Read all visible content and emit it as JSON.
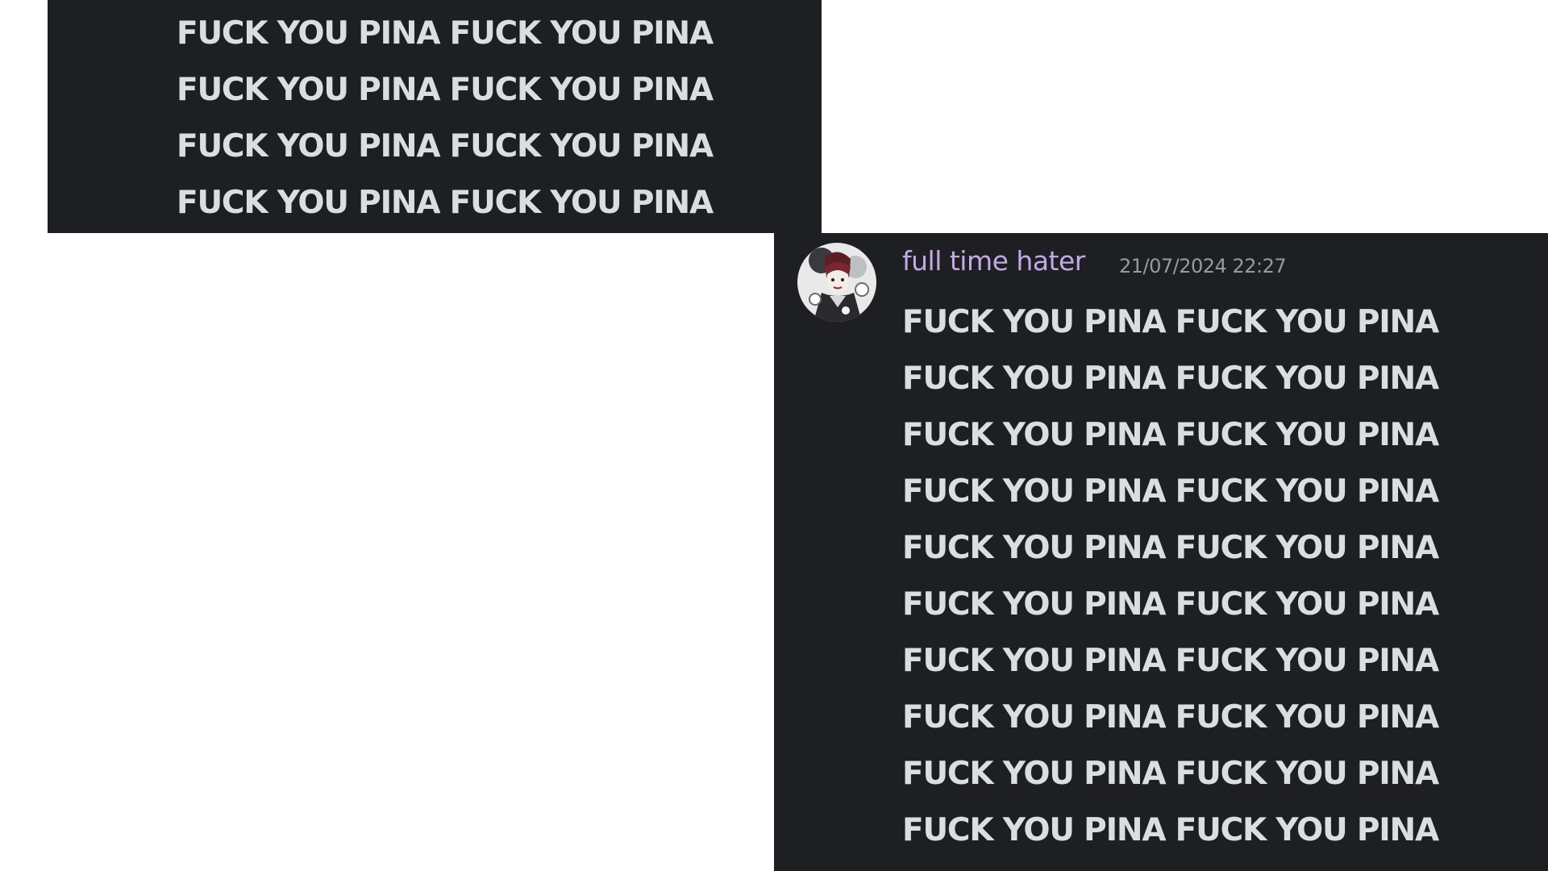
{
  "top_message": {
    "lines": [
      "FUCK YOU PINA FUCK YOU PINA",
      "FUCK YOU PINA FUCK YOU PINA",
      "FUCK YOU PINA FUCK YOU PINA",
      "FUCK YOU PINA FUCK YOU PINA"
    ]
  },
  "bottom_message": {
    "username": "full time hater",
    "timestamp": "21/07/2024 22:27",
    "avatar_icon": "avatar-icon",
    "lines": [
      "FUCK YOU PINA FUCK YOU PINA",
      "FUCK YOU PINA FUCK YOU PINA",
      "FUCK YOU PINA FUCK YOU PINA",
      "FUCK YOU PINA FUCK YOU PINA",
      "FUCK YOU PINA FUCK YOU PINA",
      "FUCK YOU PINA FUCK YOU PINA",
      "FUCK YOU PINA FUCK YOU PINA",
      "FUCK YOU PINA FUCK YOU PINA",
      "FUCK YOU PINA FUCK YOU PINA",
      "FUCK YOU PINA FUCK YOU PINA"
    ]
  },
  "colors": {
    "panel_background": "#1e1f22",
    "message_text": "#dbdee1",
    "username": "#c3a8e6",
    "timestamp": "#949ba4",
    "page_background": "#ffffff"
  }
}
